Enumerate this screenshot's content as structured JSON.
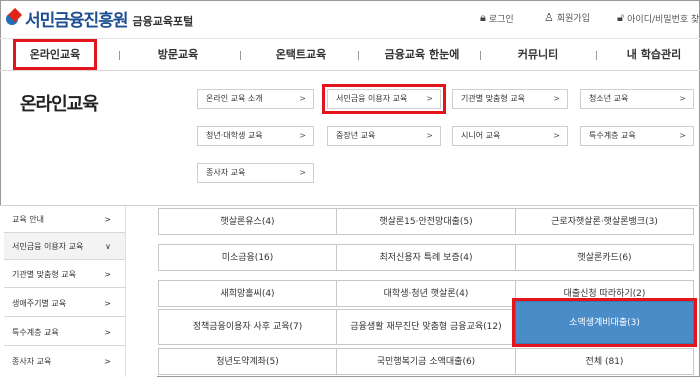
{
  "header": {
    "logo_text": "서민금융진흥원",
    "portal_name": "금융교육포털",
    "util": [
      {
        "icon": "lock-icon",
        "label": "로그인"
      },
      {
        "icon": "person-add-icon",
        "label": "회원가입"
      },
      {
        "icon": "key-lock-icon",
        "label": "아이디/비밀번호 찾"
      }
    ]
  },
  "nav": {
    "items": [
      "온라인교육",
      "방문교육",
      "온택트교육",
      "금융교육 한눈에",
      "커뮤니티",
      "내 학습관리"
    ],
    "separator": "|"
  },
  "panel": {
    "title": "온라인교육",
    "categories": [
      "온라인 교육 소개",
      "서민금융 이용자 교육",
      "기관별 맞춤형 교육",
      "청소년 교육",
      "청년·대학생 교육",
      "중장년 교육",
      "시니어 교육",
      "특수계층 교육",
      "종사자 교육"
    ],
    "arrow": ">"
  },
  "sidebar": {
    "items": [
      {
        "label": "교육 안내",
        "arrow": ">"
      },
      {
        "label": "서민금융 이용자 교육",
        "arrow": "∨"
      },
      {
        "label": "기관별 맞춤형 교육",
        "arrow": ">"
      },
      {
        "label": "생애주기별 교육",
        "arrow": ">"
      },
      {
        "label": "특수계층 교육",
        "arrow": ">"
      },
      {
        "label": "종사자 교육",
        "arrow": ">"
      }
    ]
  },
  "courses": [
    "햇살론유스(4)",
    "햇살론15·안전망대출(5)",
    "근로자햇살론·햇살론뱅크(3)",
    "미소금융(16)",
    "최저신용자 특례 보증(4)",
    "햇살론카드(6)",
    "새희망홀씨(4)",
    "대학생·청년 햇살론(4)",
    "대출신청 따라하기(2)",
    "정책금융이용자 사후 교육(7)",
    "금융생활 재무진단 맞춤형 금융교육(12)",
    "소액생계비대출(3)",
    "청년도약계좌(5)",
    "국민행복기금 소액대출(6)",
    "전체 (81)"
  ],
  "colors": {
    "highlight": "#e3141c",
    "active_cell": "#4a8cc7",
    "logo_blue": "#1d4f91"
  }
}
